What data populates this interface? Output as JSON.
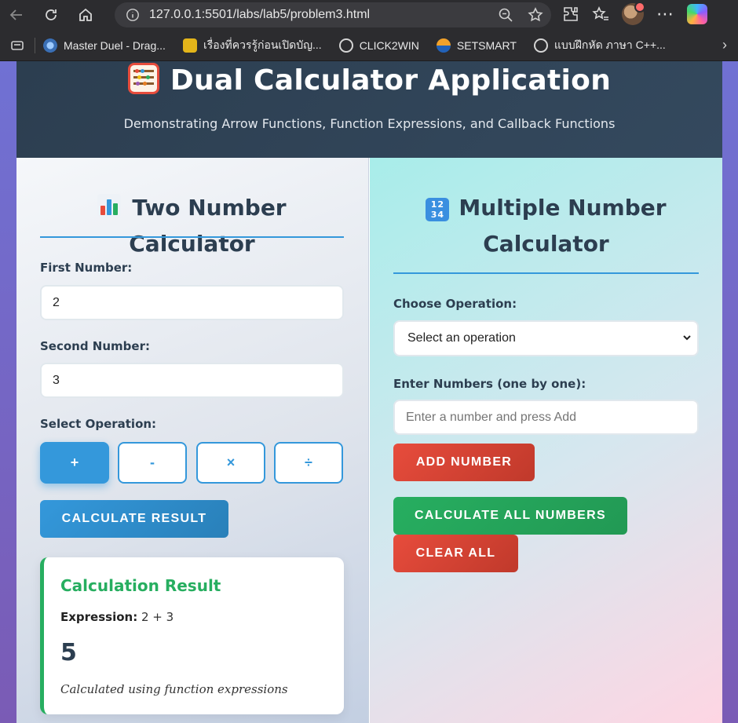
{
  "browser": {
    "url": "127.0.0.1:5501/labs/lab5/problem3.html",
    "bookmarks": [
      {
        "label": "Master Duel - Drag...",
        "icon": "duel-favicon"
      },
      {
        "label": "เรื่องที่ควรรู้ก่อนเปิดบัญ...",
        "icon": "bank-favicon"
      },
      {
        "label": "CLICK2WIN",
        "icon": "globe-icon"
      },
      {
        "label": "SETSMART",
        "icon": "setsmart-favicon"
      },
      {
        "label": "แบบฝึกหัด ภาษา C++...",
        "icon": "globe-icon"
      }
    ]
  },
  "header": {
    "title": "Dual Calculator Application",
    "subtitle": "Demonstrating Arrow Functions, Function Expressions, and Callback Functions"
  },
  "left": {
    "title": "Two Number Calculator",
    "first_label": "First Number:",
    "first_value": "2",
    "second_label": "Second Number:",
    "second_value": "3",
    "operation_label": "Select Operation:",
    "operations": [
      "+",
      "-",
      "×",
      "÷"
    ],
    "active_operation": "+",
    "calculate_label": "CALCULATE RESULT",
    "result": {
      "heading": "Calculation Result",
      "expression_label": "Expression:",
      "expression": "2 + 3",
      "value": "5",
      "note": "Calculated using function expressions"
    }
  },
  "right": {
    "title_line1": "Multiple Number",
    "title_line2": "Calculator",
    "choose_label": "Choose Operation:",
    "select_value": "Select an operation",
    "enter_label": "Enter Numbers (one by one):",
    "number_placeholder": "Enter a number and press Add",
    "add_label": "ADD NUMBER",
    "calc_all_label": "CALCULATE ALL NUMBERS",
    "clear_label": "CLEAR ALL"
  },
  "colors": {
    "accent_blue": "#3498db",
    "success_green": "#27ae60",
    "danger_red": "#e74c3c",
    "header_dark": "#2c3e50"
  }
}
